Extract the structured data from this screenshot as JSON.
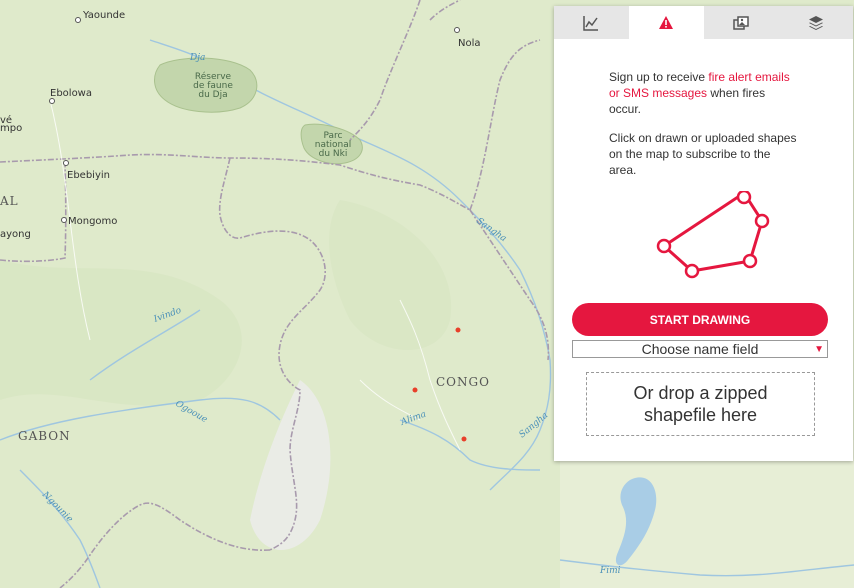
{
  "map": {
    "cities": [
      {
        "name": "Yaounde"
      },
      {
        "name": "Ebolowa"
      },
      {
        "name": "Ebebiyin"
      },
      {
        "name": "Mongomo"
      },
      {
        "name": "Nola"
      },
      {
        "name": "ayong"
      },
      {
        "name": "vé"
      },
      {
        "name": "mpo"
      },
      {
        "name": "AL"
      }
    ],
    "countries": [
      "CONGO",
      "GABON"
    ],
    "rivers": [
      "Dja",
      "Sangha",
      "Ivindo",
      "Ogooue",
      "Alima",
      "Sangha",
      "Ngounie",
      "Fimi"
    ],
    "parks": [
      {
        "lines": [
          "Réserve",
          "de faune",
          "du Dja"
        ]
      },
      {
        "lines": [
          "Parc",
          "national",
          "du Nki"
        ]
      }
    ],
    "colors": {
      "land": "#dfeacb",
      "border": "#a89aad",
      "fire": "#e8402a",
      "water": "#a9cde6"
    }
  },
  "panel": {
    "tabs": [
      {
        "icon": "line-chart-icon",
        "active": false
      },
      {
        "icon": "alert-icon",
        "active": true
      },
      {
        "icon": "image-layers-icon",
        "active": false
      },
      {
        "icon": "layers-icon",
        "active": false
      }
    ],
    "intro1_prefix": "Sign up to receive ",
    "intro1_highlight": "fire alert emails or SMS messages",
    "intro1_suffix": " when fires occur.",
    "intro2": "Click on drawn or uploaded shapes on the map to subscribe to the area.",
    "start_button": "START DRAWING",
    "name_field": "Choose name field",
    "dropzone_line1": "Or drop a zipped",
    "dropzone_line2": "shapefile here",
    "accent_color": "#e5173f"
  }
}
